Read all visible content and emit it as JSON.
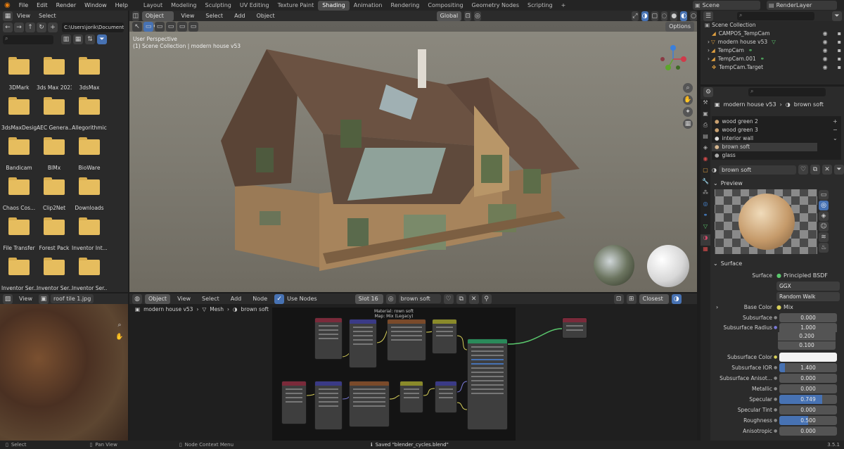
{
  "topbar": {
    "menus": [
      "File",
      "Edit",
      "Render",
      "Window",
      "Help"
    ],
    "workspaces": [
      "Layout",
      "Modeling",
      "Sculpting",
      "UV Editing",
      "Texture Paint",
      "Shading",
      "Animation",
      "Rendering",
      "Compositing",
      "Geometry Nodes",
      "Scripting"
    ],
    "active_workspace": "Shading",
    "add_tab": "+",
    "scene": "Scene",
    "render_layer": "RenderLayer"
  },
  "file_browser": {
    "menus": [
      "View",
      "Select"
    ],
    "path": "C:\\Users\\jorik\\Documents\\",
    "items": [
      "3DMark",
      "3ds Max 2023",
      "3dsMax",
      "3dsMaxDesign",
      "AEC Genera...",
      "Allegorithmic",
      "Bandicam",
      "BIMx",
      "BioWare",
      "Chaos Cos...",
      "Clip2Net",
      "Downloads",
      "File Transfer",
      "Forest Pack",
      "Inventor Int...",
      "Inventor Ser...",
      "Inventor Ser...",
      "Inventor Ser..."
    ]
  },
  "viewport": {
    "mode": "Object Mode",
    "menus": [
      "View",
      "Select",
      "Add",
      "Object"
    ],
    "transform": "Global",
    "options": "Options",
    "overlay_line1": "User Perspective",
    "overlay_line2": "(1) Scene Collection | modern house v53"
  },
  "image_editor": {
    "menus": [
      "View"
    ],
    "image_name": "roof tile 1.jpg"
  },
  "node_editor": {
    "type": "Object",
    "menus": [
      "View",
      "Select",
      "Add",
      "Node"
    ],
    "use_nodes": "Use Nodes",
    "slot": "Slot 16",
    "material": "brown soft",
    "breadcrumb": [
      "modern house v53",
      "Mesh",
      "brown soft"
    ],
    "frame_title": "Material: rown soft",
    "frame_subtitle": "Map: Mix (Legacy)",
    "interp": "Closest"
  },
  "outliner": {
    "title": "Scene Collection",
    "items": [
      {
        "name": "CAMPOS_TempCam"
      },
      {
        "name": "modern house v53"
      },
      {
        "name": "TempCam"
      },
      {
        "name": "TempCam.001"
      },
      {
        "name": "TempCam.Target"
      }
    ]
  },
  "properties": {
    "object": "modern house v53",
    "material": "brown soft",
    "slots": [
      "wood green 2",
      "wood green 3",
      "interior wall",
      "brown soft",
      "glass"
    ],
    "active_slot": "brown soft",
    "material_field": "brown soft",
    "preview_label": "Preview",
    "surface_label": "Surface",
    "rows": [
      {
        "label": "Surface",
        "value": "Principled BSDF"
      },
      {
        "label": "",
        "value": "GGX"
      },
      {
        "label": "",
        "value": "Random Walk"
      },
      {
        "label": "Base Color",
        "value": "Mix"
      },
      {
        "label": "Subsurface",
        "value": "0.000"
      },
      {
        "label": "Subsurface Radius",
        "value": "1.000"
      },
      {
        "label": "",
        "value": "0.200"
      },
      {
        "label": "",
        "value": "0.100"
      },
      {
        "label": "Subsurface Color",
        "value": ""
      },
      {
        "label": "Subsurface IOR",
        "value": "1.400"
      },
      {
        "label": "Subsurface Anisot...",
        "value": "0.000"
      },
      {
        "label": "Metallic",
        "value": "0.000"
      },
      {
        "label": "Specular",
        "value": "0.749"
      },
      {
        "label": "Specular Tint",
        "value": "0.000"
      },
      {
        "label": "Roughness",
        "value": "0.500"
      },
      {
        "label": "Anisotropic",
        "value": "0.000"
      }
    ],
    "specular_fill": 0.749,
    "roughness_fill": 0.5,
    "ior_fill": 0.1
  },
  "statusbar": {
    "select": "Select",
    "pan": "Pan View",
    "ctx": "Node Context Menu",
    "saved": "Saved \"blender_cycles.blend\"",
    "version": "3.5.1"
  },
  "colors": {
    "accent": "#4772b3",
    "folder": "#e6bd5e"
  }
}
